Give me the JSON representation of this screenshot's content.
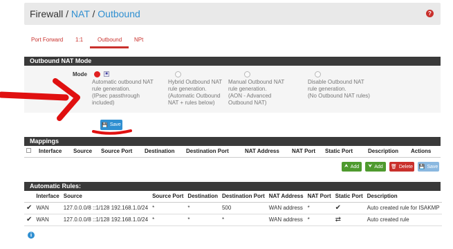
{
  "breadcrumb": {
    "part1": "Firewall",
    "sep1": " / ",
    "part2": "NAT",
    "sep2": " / ",
    "part3": "Outbound",
    "help": "?"
  },
  "tabs": [
    {
      "label": "Port Forward"
    },
    {
      "label": "1:1"
    },
    {
      "label": "Outbound",
      "active": true
    },
    {
      "label": "NPt"
    }
  ],
  "mode_panel": {
    "title": "Outbound NAT Mode",
    "mode_label": "Mode",
    "options": [
      {
        "lines": [
          "Automatic outbound NAT",
          "rule generation.",
          "(IPsec passthrough",
          "included)"
        ],
        "selected": true
      },
      {
        "lines": [
          "Hybrid Outbound NAT",
          "rule generation.",
          "(Automatic Outbound",
          "NAT + rules below)"
        ],
        "selected": false
      },
      {
        "lines": [
          "Manual Outbound NAT",
          "rule generation.",
          "(AON - Advanced",
          "Outbound NAT)"
        ],
        "selected": false
      },
      {
        "lines": [
          "Disable Outbound NAT",
          "rule generation.",
          "(No Outbound NAT rules)"
        ],
        "selected": false
      }
    ],
    "save_label": "Save"
  },
  "mappings": {
    "title": "Mappings",
    "columns": [
      "Interface",
      "Source",
      "Source Port",
      "Destination",
      "Destination Port",
      "NAT Address",
      "NAT Port",
      "Static Port",
      "Description",
      "Actions"
    ],
    "buttons": {
      "add_top": "Add",
      "add_bottom": "Add",
      "delete": "Delete",
      "save": "Save"
    }
  },
  "auto_rules": {
    "title": "Automatic Rules:",
    "columns": [
      "Interface",
      "Source",
      "Source Port",
      "Destination",
      "Destination Port",
      "NAT Address",
      "NAT Port",
      "Static Port",
      "Description"
    ],
    "rows": [
      {
        "interface": "WAN",
        "source": "127.0.0.0/8 ::1/128 192.168.1.0/24",
        "source_port": "*",
        "destination": "*",
        "dest_port": "500",
        "nat_address": "WAN address",
        "nat_port": "*",
        "static_icon": "check-icon",
        "description": "Auto created rule for ISAKMP"
      },
      {
        "interface": "WAN",
        "source": "127.0.0.0/8 ::1/128 192.168.1.0/24",
        "source_port": "*",
        "destination": "*",
        "dest_port": "*",
        "nat_address": "WAN address",
        "nat_port": "*",
        "static_icon": "shuffle-icon",
        "description": "Auto created rule"
      }
    ]
  },
  "colors": {
    "accent": "#c9302c",
    "link": "#2f8fd1",
    "header": "#3a3a3a"
  }
}
